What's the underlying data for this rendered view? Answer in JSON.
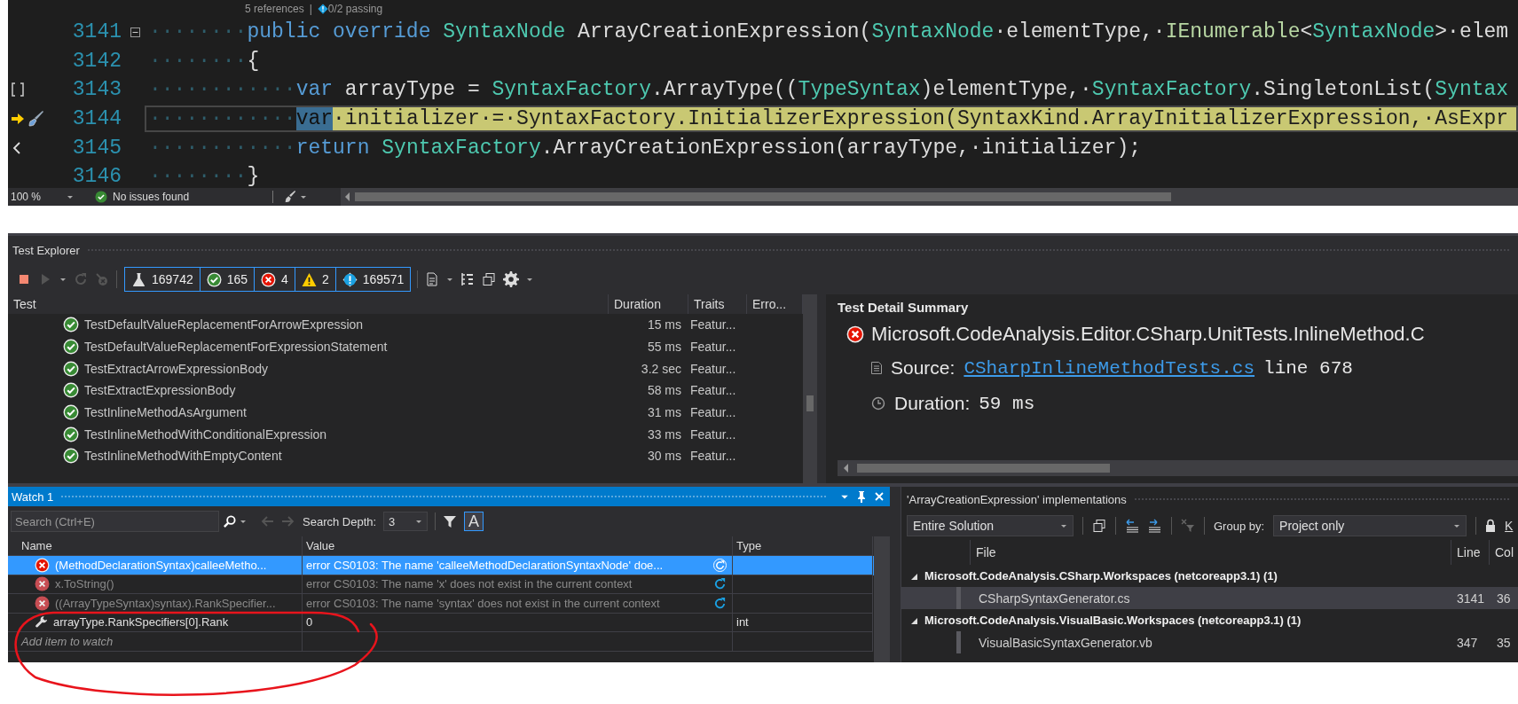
{
  "editor": {
    "codelens": {
      "references": "5 references",
      "separator": "|",
      "tests": "0/2 passing"
    },
    "lines": [
      {
        "number": "3141",
        "foldable": true,
        "current": false,
        "highlighted": false,
        "bracket_glyph": false,
        "chevron_glyph": false,
        "indent": "········",
        "tokens": [
          {
            "kind": "keyword",
            "text": "public"
          },
          {
            "kind": "keyword",
            "text": " override"
          },
          {
            "kind": "type",
            "text": " SyntaxNode"
          },
          {
            "kind": "plain",
            "text": " ArrayCreationExpression("
          },
          {
            "kind": "type",
            "text": "SyntaxNode"
          },
          {
            "kind": "plain",
            "text": "·elementType,·"
          },
          {
            "kind": "interface",
            "text": "IEnumerable"
          },
          {
            "kind": "plain",
            "text": "<"
          },
          {
            "kind": "type",
            "text": "SyntaxNode"
          },
          {
            "kind": "plain",
            "text": ">·elem"
          }
        ]
      },
      {
        "number": "3142",
        "foldable": false,
        "current": false,
        "highlighted": false,
        "bracket_glyph": false,
        "chevron_glyph": false,
        "indent": "········",
        "tokens": [
          {
            "kind": "plain",
            "text": "{"
          }
        ]
      },
      {
        "number": "3143",
        "foldable": false,
        "current": false,
        "highlighted": false,
        "bracket_glyph": true,
        "chevron_glyph": false,
        "indent": "············",
        "tokens": [
          {
            "kind": "keyword",
            "text": "var"
          },
          {
            "kind": "plain",
            "text": " arrayType = "
          },
          {
            "kind": "type",
            "text": "SyntaxFactory"
          },
          {
            "kind": "plain",
            "text": ".ArrayType(("
          },
          {
            "kind": "type",
            "text": "TypeSyntax"
          },
          {
            "kind": "plain",
            "text": ")elementType,·"
          },
          {
            "kind": "type",
            "text": "SyntaxFactory"
          },
          {
            "kind": "plain",
            "text": ".SingletonList("
          },
          {
            "kind": "type",
            "text": "Syntax"
          }
        ]
      },
      {
        "number": "3144",
        "foldable": false,
        "current": true,
        "highlighted": true,
        "bracket_glyph": false,
        "chevron_glyph": false,
        "indent": "············",
        "tokens": [
          {
            "kind": "selection",
            "text": "var"
          },
          {
            "kind": "plain",
            "text": "·initializer·=·SyntaxFactory.InitializerExpression(SyntaxKind.ArrayInitializerExpression,·AsExpr"
          }
        ]
      },
      {
        "number": "3145",
        "foldable": false,
        "current": false,
        "highlighted": false,
        "bracket_glyph": false,
        "chevron_glyph": true,
        "indent": "············",
        "tokens": [
          {
            "kind": "keyword",
            "text": "return"
          },
          {
            "kind": "type",
            "text": " SyntaxFactory"
          },
          {
            "kind": "plain",
            "text": ".ArrayCreationExpression(arrayType,·initializer);"
          }
        ]
      },
      {
        "number": "3146",
        "foldable": false,
        "current": false,
        "highlighted": false,
        "bracket_glyph": false,
        "chevron_glyph": false,
        "indent": "········",
        "tokens": [
          {
            "kind": "plain",
            "text": "}"
          }
        ]
      }
    ]
  },
  "editor_status": {
    "zoom": "100 %",
    "issues": "No issues found"
  },
  "test_explorer": {
    "title": "Test Explorer",
    "counters": [
      {
        "kind": "total",
        "count": "169742"
      },
      {
        "kind": "passed",
        "count": "165"
      },
      {
        "kind": "failed",
        "count": "4"
      },
      {
        "kind": "warning",
        "count": "2"
      },
      {
        "kind": "not_run",
        "count": "169571"
      }
    ],
    "columns": [
      "Test",
      "Duration",
      "Traits",
      "Erro..."
    ],
    "rows": [
      {
        "name": "TestDefaultValueReplacementForArrowExpression",
        "duration": "15 ms",
        "traits": "Featur...",
        "passed": true
      },
      {
        "name": "TestDefaultValueReplacementForExpressionStatement",
        "duration": "55 ms",
        "traits": "Featur...",
        "passed": true
      },
      {
        "name": "TestExtractArrowExpressionBody",
        "duration": "3.2 sec",
        "traits": "Featur...",
        "passed": true
      },
      {
        "name": "TestExtractExpressionBody",
        "duration": "58 ms",
        "traits": "Featur...",
        "passed": true
      },
      {
        "name": "TestInlineMethodAsArgument",
        "duration": "31 ms",
        "traits": "Featur...",
        "passed": true
      },
      {
        "name": "TestInlineMethodWithConditionalExpression",
        "duration": "33 ms",
        "traits": "Featur...",
        "passed": true
      },
      {
        "name": "TestInlineMethodWithEmptyContent",
        "duration": "30 ms",
        "traits": "Featur...",
        "passed": true
      }
    ],
    "detail": {
      "heading": "Test Detail Summary",
      "passed": false,
      "test_name": "Microsoft.CodeAnalysis.Editor.CSharp.UnitTests.InlineMethod.C",
      "source_label": "Source:",
      "source_file": "CSharpInlineMethodTests.cs",
      "source_line": "line 678",
      "duration_label": "Duration:",
      "duration": "59 ms"
    }
  },
  "watch": {
    "title": "Watch 1",
    "search_placeholder": "Search (Ctrl+E)",
    "depth_label": "Search Depth:",
    "depth": "3",
    "case_toggle": {
      "label": "A",
      "on": true
    },
    "columns": [
      "Name",
      "Value",
      "Type"
    ],
    "rows": [
      {
        "kind": "error",
        "name": "(MethodDeclarationSyntax)calleeMetho...",
        "value": "error CS0103: The name 'calleeMethodDeclarationSyntaxNode' doe...",
        "type": "",
        "selected": true,
        "stale": false
      },
      {
        "kind": "error",
        "name": "x.ToString()",
        "value": "error CS0103: The name 'x' does not exist in the current context",
        "type": "",
        "selected": false,
        "stale": true
      },
      {
        "kind": "error",
        "name": "((ArrayTypeSyntax)syntax).RankSpecifier...",
        "value": "error CS0103: The name 'syntax' does not exist in the current context",
        "type": "",
        "selected": false,
        "stale": true
      },
      {
        "kind": "value",
        "name": "arrayType.RankSpecifiers[0].Rank",
        "value": "0",
        "type": "int",
        "selected": false,
        "stale": false
      }
    ],
    "add_placeholder": "Add item to watch"
  },
  "implementations": {
    "title": "'ArrayCreationExpression' implementations",
    "scope": "Entire Solution",
    "group_by_label": "Group by:",
    "group_by": "Project only",
    "link": "K",
    "columns": [
      "File",
      "Line",
      "Col"
    ],
    "groups": [
      {
        "name": "Microsoft.CodeAnalysis.CSharp.Workspaces (netcoreapp3.1)  (1)",
        "expanded": true,
        "children": [
          {
            "file": "CSharpSyntaxGenerator.cs",
            "line": "3141",
            "col": "36",
            "selected": true
          }
        ]
      },
      {
        "name": "Microsoft.CodeAnalysis.VisualBasic.Workspaces (netcoreapp3.1)  (1)",
        "expanded": true,
        "children": [
          {
            "file": "VisualBasicSyntaxGenerator.vb",
            "line": "347",
            "col": "35",
            "selected": false
          }
        ]
      }
    ]
  }
}
